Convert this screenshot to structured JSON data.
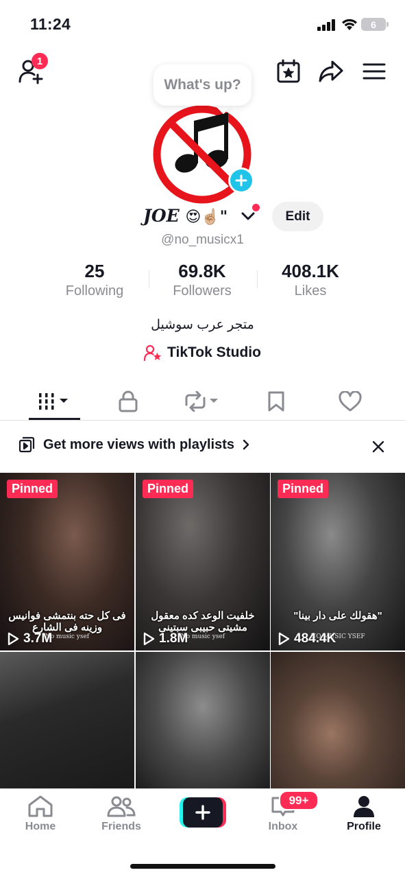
{
  "status_bar": {
    "time": "11:24",
    "battery": "6"
  },
  "top_nav": {
    "friend_request_count": "1"
  },
  "bubble": {
    "text": "What's up?"
  },
  "profile": {
    "name": "JOE",
    "name_suffix": "😍☝🏼\"",
    "edit_label": "Edit",
    "handle": "@no_musicx1",
    "bio": "متجر عرب سوشيل",
    "studio_label": "TikTok Studio"
  },
  "stats": [
    {
      "value": "25",
      "label": "Following"
    },
    {
      "value": "69.8K",
      "label": "Followers"
    },
    {
      "value": "408.1K",
      "label": "Likes"
    }
  ],
  "tabs": [
    {
      "icon": "videos-grid-icon",
      "active": true
    },
    {
      "icon": "lock-icon"
    },
    {
      "icon": "repost-icon"
    },
    {
      "icon": "bookmark-icon"
    },
    {
      "icon": "heart-icon"
    }
  ],
  "playlist_banner": {
    "text": "Get more views with playlists"
  },
  "videos": [
    {
      "pinned": "Pinned",
      "views": "3.7M",
      "caption": "فى كل حته بنتمشى فوانيس وزينه فى الشارع",
      "watermark": "No music ysef"
    },
    {
      "pinned": "Pinned",
      "views": "1.8M",
      "caption": "خلفيت الوعد كده معقول مشيتى حبيبى سبتينى",
      "watermark": "No music ysef"
    },
    {
      "pinned": "Pinned",
      "views": "484.4K",
      "caption": "\"هقولك على دار بينا\"",
      "watermark": "NO MUSIC YSEF"
    },
    {},
    {},
    {}
  ],
  "bottom_nav": {
    "home": "Home",
    "friends": "Friends",
    "inbox": "Inbox",
    "inbox_badge": "99+",
    "profile": "Profile"
  },
  "colors": {
    "accent": "#fe2c55",
    "cyan": "#25f4ee",
    "text": "#161823",
    "muted": "#8a8b91"
  }
}
